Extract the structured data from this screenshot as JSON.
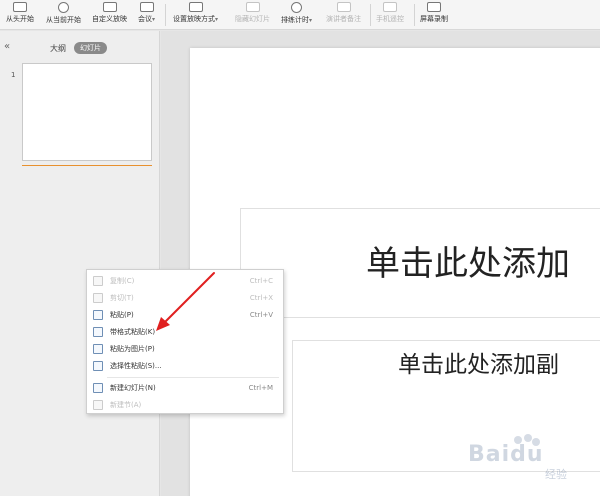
{
  "toolbar": {
    "items": [
      {
        "label": "从头开始",
        "disabled": false
      },
      {
        "label": "从当前开始",
        "disabled": false
      },
      {
        "label": "自定义放映",
        "disabled": false
      },
      {
        "label": "会议",
        "disabled": false
      },
      {
        "label": "设置放映方式",
        "disabled": false
      },
      {
        "label": "隐藏幻灯片",
        "disabled": true
      },
      {
        "label": "排练计时",
        "disabled": false
      },
      {
        "label": "演讲者备注",
        "disabled": true
      },
      {
        "label": "手机遥控",
        "disabled": true
      },
      {
        "label": "屏幕录制",
        "disabled": false
      }
    ]
  },
  "left_panel": {
    "collapse_glyph": "«",
    "tab_outline": "大纲",
    "tab_slides": "幻灯片",
    "slide_number": "1"
  },
  "slide": {
    "title": "单击此处添加",
    "subtitle": "单击此处添加副"
  },
  "context_menu": {
    "items": [
      {
        "label": "复制(C)",
        "shortcut": "Ctrl+C",
        "disabled": true
      },
      {
        "label": "剪切(T)",
        "shortcut": "Ctrl+X",
        "disabled": true
      },
      {
        "label": "粘贴(P)",
        "shortcut": "Ctrl+V",
        "disabled": false
      },
      {
        "label": "带格式粘贴(K)",
        "shortcut": "",
        "disabled": false
      },
      {
        "label": "粘贴为图片(P)",
        "shortcut": "",
        "disabled": false
      },
      {
        "label": "选择性粘贴(S)...",
        "shortcut": "",
        "disabled": false
      },
      {
        "label": "新建幻灯片(N)",
        "shortcut": "Ctrl+M",
        "disabled": false
      },
      {
        "label": "新建节(A)",
        "shortcut": "",
        "disabled": true
      }
    ]
  },
  "annotation": {
    "arrow_color": "#e02020"
  },
  "watermark": {
    "text": "Baidu",
    "sub": "经验"
  }
}
